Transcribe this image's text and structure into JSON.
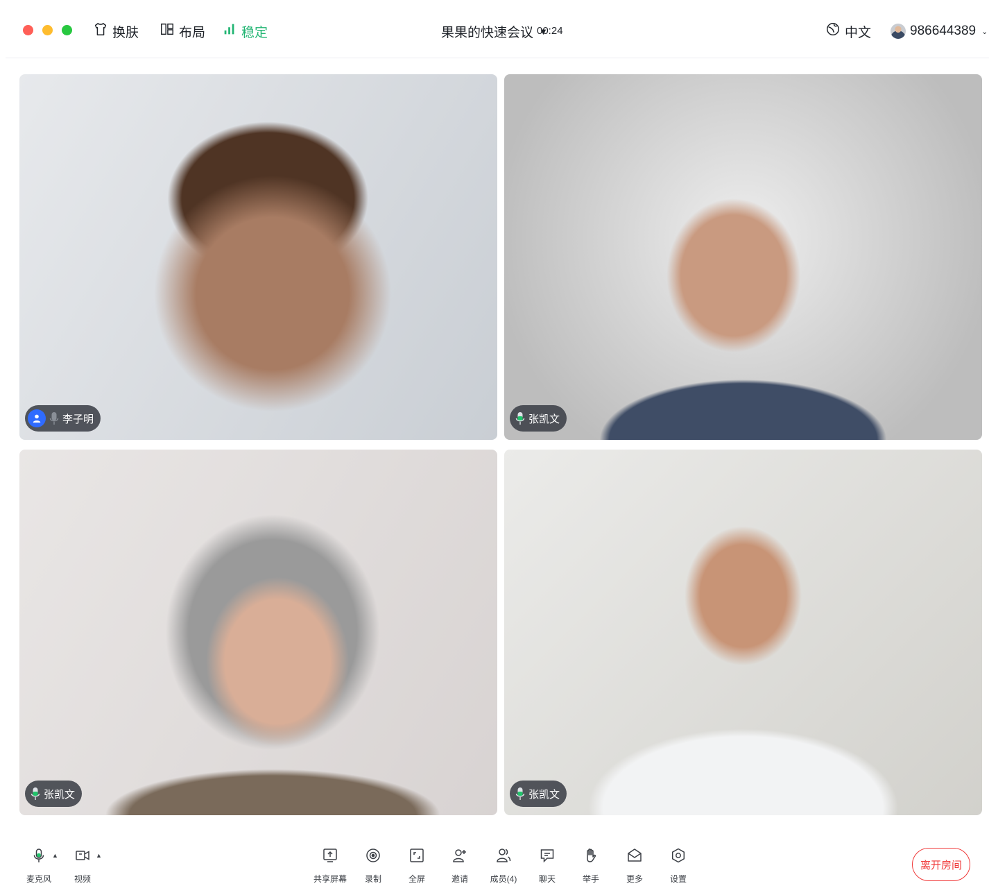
{
  "titlebar": {
    "skin_label": "换肤",
    "layout_label": "布局",
    "network_label": "稳定",
    "meeting_title": "果果的快速会议",
    "meeting_caret": "▼",
    "timer": "00:24",
    "language_label": "中文",
    "user_id": "986644389",
    "user_caret": "⌄"
  },
  "participants": [
    {
      "name": "李子明"
    },
    {
      "name": "张凯文"
    },
    {
      "name": "张凯文"
    },
    {
      "name": "张凯文"
    }
  ],
  "toolbar": {
    "mic_label": "麦克风",
    "video_label": "视频",
    "arrow": "▲",
    "share_label": "共享屏幕",
    "record_label": "录制",
    "fullscreen_label": "全屏",
    "invite_label": "邀请",
    "members_label": "成员(4)",
    "chat_label": "聊天",
    "raise_hand_label": "举手",
    "more_label": "更多",
    "settings_label": "设置",
    "leave_label": "离开房间"
  },
  "colors": {
    "accent_green": "#22b573",
    "leave_red": "#f03a3a",
    "badge_blue": "#2f6bff",
    "mic_active": "#21c46b"
  }
}
